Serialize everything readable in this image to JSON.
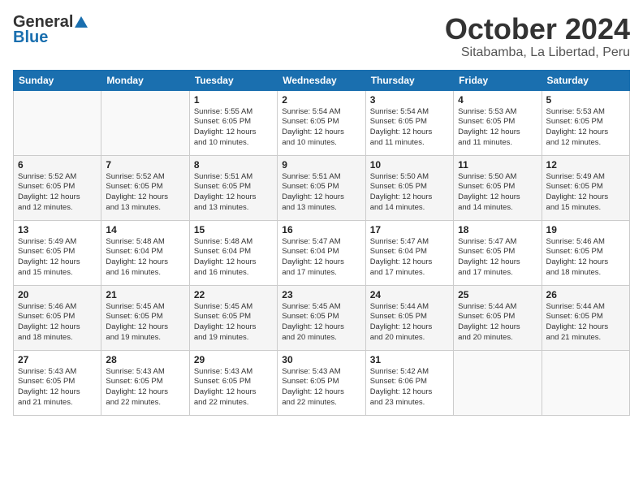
{
  "header": {
    "logo_general": "General",
    "logo_blue": "Blue",
    "title": "October 2024",
    "location": "Sitabamba, La Libertad, Peru"
  },
  "days_of_week": [
    "Sunday",
    "Monday",
    "Tuesday",
    "Wednesday",
    "Thursday",
    "Friday",
    "Saturday"
  ],
  "weeks": [
    [
      {
        "day": "",
        "info": ""
      },
      {
        "day": "",
        "info": ""
      },
      {
        "day": "1",
        "info": "Sunrise: 5:55 AM\nSunset: 6:05 PM\nDaylight: 12 hours\nand 10 minutes."
      },
      {
        "day": "2",
        "info": "Sunrise: 5:54 AM\nSunset: 6:05 PM\nDaylight: 12 hours\nand 10 minutes."
      },
      {
        "day": "3",
        "info": "Sunrise: 5:54 AM\nSunset: 6:05 PM\nDaylight: 12 hours\nand 11 minutes."
      },
      {
        "day": "4",
        "info": "Sunrise: 5:53 AM\nSunset: 6:05 PM\nDaylight: 12 hours\nand 11 minutes."
      },
      {
        "day": "5",
        "info": "Sunrise: 5:53 AM\nSunset: 6:05 PM\nDaylight: 12 hours\nand 12 minutes."
      }
    ],
    [
      {
        "day": "6",
        "info": "Sunrise: 5:52 AM\nSunset: 6:05 PM\nDaylight: 12 hours\nand 12 minutes."
      },
      {
        "day": "7",
        "info": "Sunrise: 5:52 AM\nSunset: 6:05 PM\nDaylight: 12 hours\nand 13 minutes."
      },
      {
        "day": "8",
        "info": "Sunrise: 5:51 AM\nSunset: 6:05 PM\nDaylight: 12 hours\nand 13 minutes."
      },
      {
        "day": "9",
        "info": "Sunrise: 5:51 AM\nSunset: 6:05 PM\nDaylight: 12 hours\nand 13 minutes."
      },
      {
        "day": "10",
        "info": "Sunrise: 5:50 AM\nSunset: 6:05 PM\nDaylight: 12 hours\nand 14 minutes."
      },
      {
        "day": "11",
        "info": "Sunrise: 5:50 AM\nSunset: 6:05 PM\nDaylight: 12 hours\nand 14 minutes."
      },
      {
        "day": "12",
        "info": "Sunrise: 5:49 AM\nSunset: 6:05 PM\nDaylight: 12 hours\nand 15 minutes."
      }
    ],
    [
      {
        "day": "13",
        "info": "Sunrise: 5:49 AM\nSunset: 6:05 PM\nDaylight: 12 hours\nand 15 minutes."
      },
      {
        "day": "14",
        "info": "Sunrise: 5:48 AM\nSunset: 6:04 PM\nDaylight: 12 hours\nand 16 minutes."
      },
      {
        "day": "15",
        "info": "Sunrise: 5:48 AM\nSunset: 6:04 PM\nDaylight: 12 hours\nand 16 minutes."
      },
      {
        "day": "16",
        "info": "Sunrise: 5:47 AM\nSunset: 6:04 PM\nDaylight: 12 hours\nand 17 minutes."
      },
      {
        "day": "17",
        "info": "Sunrise: 5:47 AM\nSunset: 6:04 PM\nDaylight: 12 hours\nand 17 minutes."
      },
      {
        "day": "18",
        "info": "Sunrise: 5:47 AM\nSunset: 6:05 PM\nDaylight: 12 hours\nand 17 minutes."
      },
      {
        "day": "19",
        "info": "Sunrise: 5:46 AM\nSunset: 6:05 PM\nDaylight: 12 hours\nand 18 minutes."
      }
    ],
    [
      {
        "day": "20",
        "info": "Sunrise: 5:46 AM\nSunset: 6:05 PM\nDaylight: 12 hours\nand 18 minutes."
      },
      {
        "day": "21",
        "info": "Sunrise: 5:45 AM\nSunset: 6:05 PM\nDaylight: 12 hours\nand 19 minutes."
      },
      {
        "day": "22",
        "info": "Sunrise: 5:45 AM\nSunset: 6:05 PM\nDaylight: 12 hours\nand 19 minutes."
      },
      {
        "day": "23",
        "info": "Sunrise: 5:45 AM\nSunset: 6:05 PM\nDaylight: 12 hours\nand 20 minutes."
      },
      {
        "day": "24",
        "info": "Sunrise: 5:44 AM\nSunset: 6:05 PM\nDaylight: 12 hours\nand 20 minutes."
      },
      {
        "day": "25",
        "info": "Sunrise: 5:44 AM\nSunset: 6:05 PM\nDaylight: 12 hours\nand 20 minutes."
      },
      {
        "day": "26",
        "info": "Sunrise: 5:44 AM\nSunset: 6:05 PM\nDaylight: 12 hours\nand 21 minutes."
      }
    ],
    [
      {
        "day": "27",
        "info": "Sunrise: 5:43 AM\nSunset: 6:05 PM\nDaylight: 12 hours\nand 21 minutes."
      },
      {
        "day": "28",
        "info": "Sunrise: 5:43 AM\nSunset: 6:05 PM\nDaylight: 12 hours\nand 22 minutes."
      },
      {
        "day": "29",
        "info": "Sunrise: 5:43 AM\nSunset: 6:05 PM\nDaylight: 12 hours\nand 22 minutes."
      },
      {
        "day": "30",
        "info": "Sunrise: 5:43 AM\nSunset: 6:05 PM\nDaylight: 12 hours\nand 22 minutes."
      },
      {
        "day": "31",
        "info": "Sunrise: 5:42 AM\nSunset: 6:06 PM\nDaylight: 12 hours\nand 23 minutes."
      },
      {
        "day": "",
        "info": ""
      },
      {
        "day": "",
        "info": ""
      }
    ]
  ]
}
